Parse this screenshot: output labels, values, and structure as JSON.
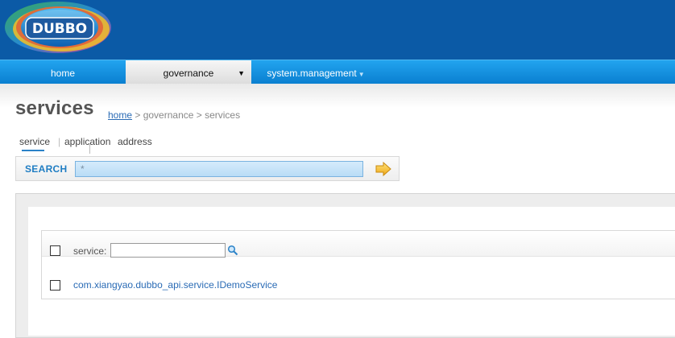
{
  "app": {
    "logo_text": "DUBBO"
  },
  "nav": {
    "items": [
      {
        "label": "home"
      },
      {
        "label": "governance",
        "caret": "▼"
      },
      {
        "label": "system.management",
        "caret": "▼"
      }
    ]
  },
  "page": {
    "title": "services"
  },
  "breadcrumb": {
    "home": "home",
    "rest": " > governance > services"
  },
  "subtabs": {
    "service": "service",
    "separator": "|",
    "application": "application",
    "address": "address"
  },
  "search": {
    "label": "SEARCH",
    "value": "*"
  },
  "table": {
    "filter_label": "service:",
    "filter_value": "",
    "rows": [
      {
        "service": "com.xiangyao.dubbo_api.service.IDemoService"
      }
    ]
  },
  "colors": {
    "header": "#0b5aa6",
    "nav": "#0a7fd0",
    "accent": "#1f7dc3",
    "link": "#2a6bb5"
  },
  "icons": {
    "search_go": "arrow-right-icon",
    "filter": "magnifier-icon"
  }
}
